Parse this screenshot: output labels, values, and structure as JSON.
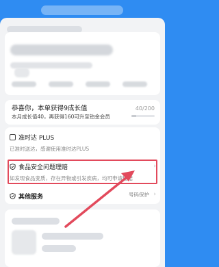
{
  "award": {
    "title": "恭喜你，本单获得9成长值",
    "subtitle": "本月成长值40，再获得160可升至铂金会员",
    "progress_text": "40/200",
    "progress_fraction": 0.2
  },
  "on_time": {
    "title": "准时达 PLUS",
    "desc": "已准时送达，感谢使用准时达PLUS"
  },
  "food_safety": {
    "title": "食品安全问题理赔",
    "desc": "如发现食品变质，存在异物或引发疾病，均可申请理赔"
  },
  "other": {
    "title": "其他服务",
    "right_label": "号码保护"
  },
  "colors": {
    "header_blue": "#2f8cf2",
    "highlight_red": "#e24a5c"
  }
}
